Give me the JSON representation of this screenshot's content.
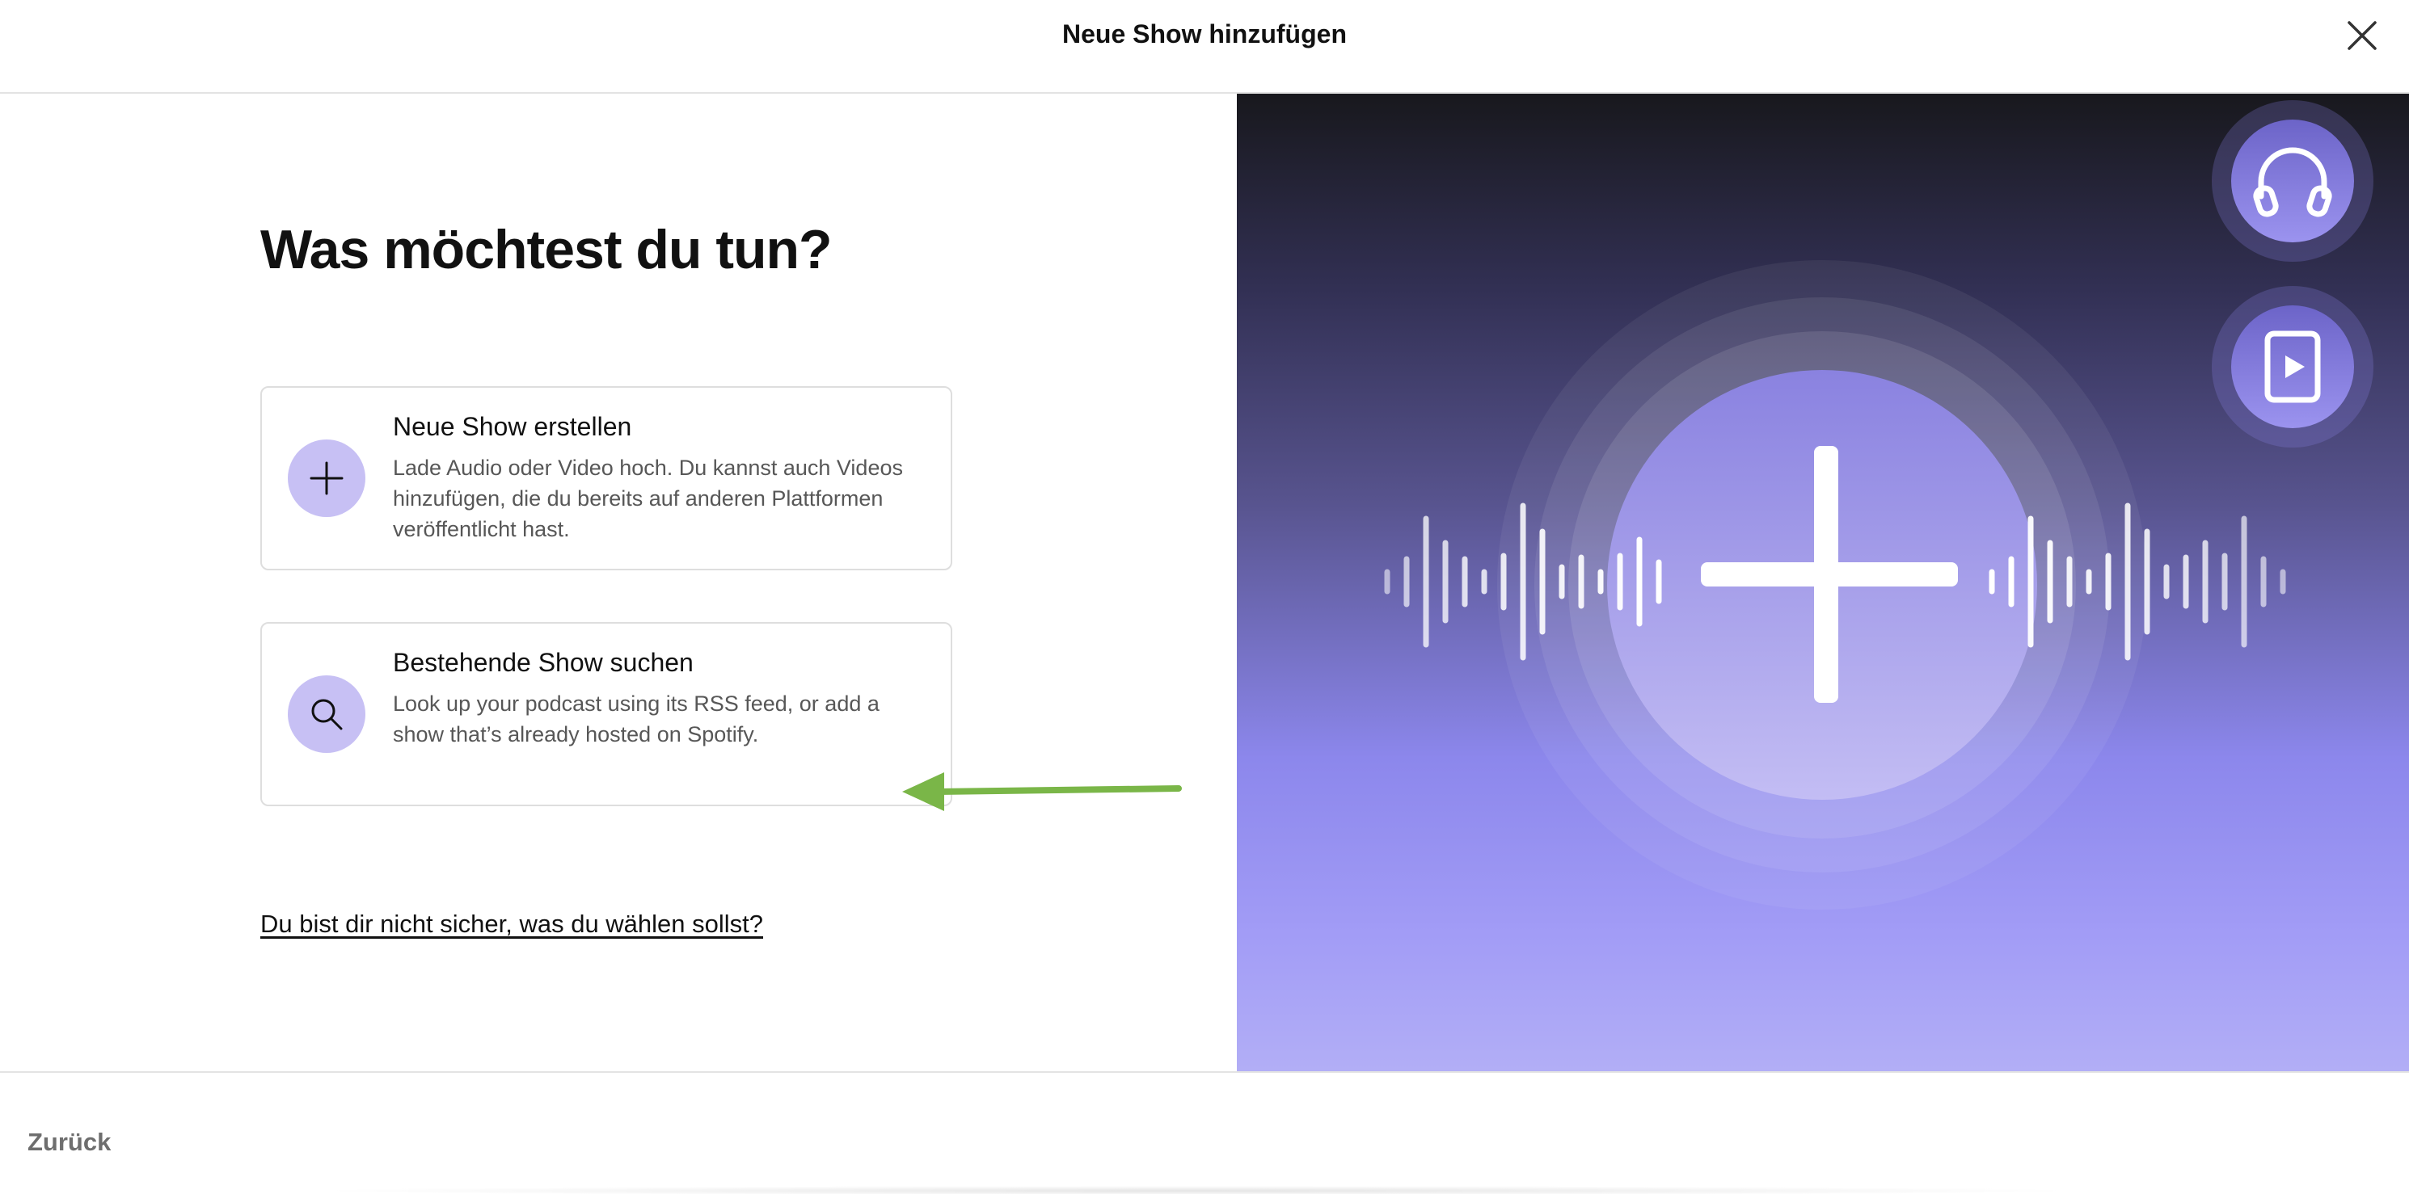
{
  "header": {
    "title": "Neue Show hinzufügen",
    "close_icon": "close-icon"
  },
  "main": {
    "heading": "Was möchtest du tun?",
    "options": [
      {
        "title": "Neue Show erstellen",
        "description": "Lade Audio oder Video hoch. Du kannst auch Videos hinzufügen, die du bereits auf anderen Plattformen veröffentlicht hast.",
        "icon": "plus-icon"
      },
      {
        "title": "Bestehende Show suchen",
        "description": "Look up your podcast using its RSS feed, or add a show that’s already hosted on Spotify.",
        "icon": "search-icon"
      }
    ],
    "help_link": "Du bist dir nicht sicher, was du wählen sollst?"
  },
  "illustration": {
    "side_icons": [
      "headphones-icon",
      "video-play-icon"
    ],
    "center_icon": "plus-icon",
    "annotation": "green-arrow-icon"
  },
  "colors": {
    "accent_light": "#c7c0f4",
    "arrow_green": "#7ab648",
    "gradient_top": "#18181d",
    "gradient_bottom": "#b2aef6"
  },
  "footer": {
    "back_label": "Zurück"
  }
}
